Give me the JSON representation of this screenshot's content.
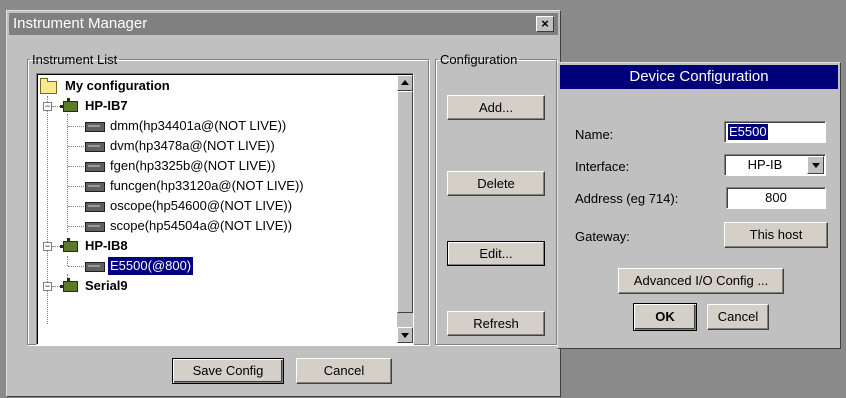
{
  "instrument_manager": {
    "title": "Instrument Manager",
    "close_glyph": "×",
    "instrument_list_label": "Instrument List",
    "configuration_label": "Configuration",
    "tree": {
      "root": "My configuration",
      "buses": [
        {
          "name": "HP-IB7",
          "expander": "−",
          "devices": [
            "dmm(hp34401a@(NOT LIVE))",
            "dvm(hp3478a@(NOT LIVE))",
            "fgen(hp3325b@(NOT LIVE))",
            "funcgen(hp33120a@(NOT LIVE))",
            "oscope(hp54600@(NOT LIVE))",
            "scope(hp54504a@(NOT LIVE))"
          ]
        },
        {
          "name": "HP-IB8",
          "expander": "−",
          "devices": [
            "E5500(@800)"
          ]
        },
        {
          "name": "Serial9",
          "expander": "−",
          "devices": []
        }
      ],
      "selected_device": "E5500(@800)"
    },
    "buttons": {
      "add": "Add...",
      "delete": "Delete",
      "edit": "Edit...",
      "refresh": "Refresh",
      "save_config": "Save Config",
      "cancel": "Cancel"
    }
  },
  "device_configuration": {
    "title": "Device Configuration",
    "name_label": "Name:",
    "name_value": "E5500",
    "interface_label": "Interface:",
    "interface_value": "HP-IB",
    "address_label": "Address (eg 714):",
    "address_value": "800",
    "gateway_label": "Gateway:",
    "gateway_button": "This host",
    "advanced_button": "Advanced I/O Config ...",
    "ok_button": "OK",
    "cancel_button": "Cancel"
  },
  "icons": {
    "folder": "folder-icon",
    "bus": "bus-icon",
    "device": "instrument-icon"
  },
  "colors": {
    "active_title": "#00007a",
    "inactive_title": "#808080",
    "selection": "#000080",
    "face": "#c0c0c0"
  }
}
